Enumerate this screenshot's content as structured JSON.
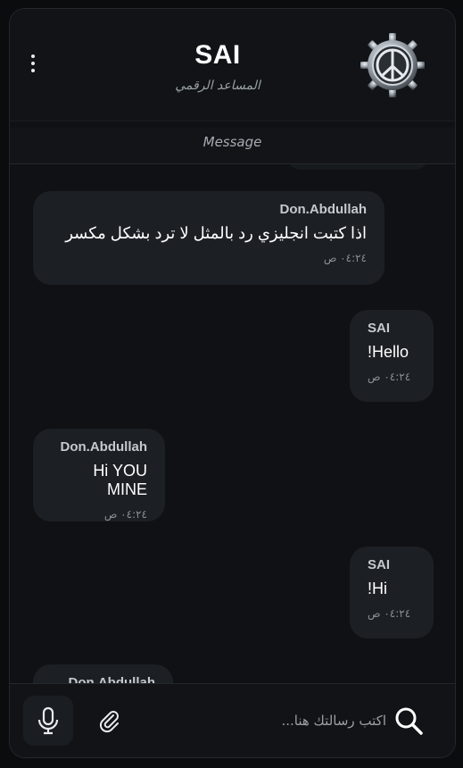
{
  "header": {
    "title": "SAI",
    "subtitle": "المساعد الرقمي",
    "menu_icon": "more-vertical-icon",
    "logo_icon": "gear-peace-emblem-icon"
  },
  "banner": {
    "label": "Message"
  },
  "messages": [
    {
      "sender": "Don.Abdullah",
      "text": "اذا كتبت انجليزي رد بالمثل لا ترد بشكل مكسر",
      "time": "٠٤:٢٤ ص",
      "role": "user"
    },
    {
      "sender": "SAI",
      "text": "Hello!",
      "time": "٠٤:٢٤ ص",
      "role": "ai"
    },
    {
      "sender": "Don.Abdullah",
      "text": "Hi YOU MINE",
      "time": "٠٤:٢٤ ص",
      "role": "user"
    },
    {
      "sender": "SAI",
      "text": "Hi!",
      "time": "٠٤:٢٤ ص",
      "role": "ai"
    },
    {
      "sender": "Don.Abdullah",
      "role": "user"
    }
  ],
  "composer": {
    "placeholder": "اكتب رسالتك هنا...",
    "mic_icon": "microphone-icon",
    "attach_icon": "paperclip-icon",
    "search_icon": "search-icon"
  },
  "colors": {
    "background": "#0f1114",
    "bubble": "#1c1f24",
    "text": "#ffffff",
    "muted": "#9aa0a6"
  }
}
